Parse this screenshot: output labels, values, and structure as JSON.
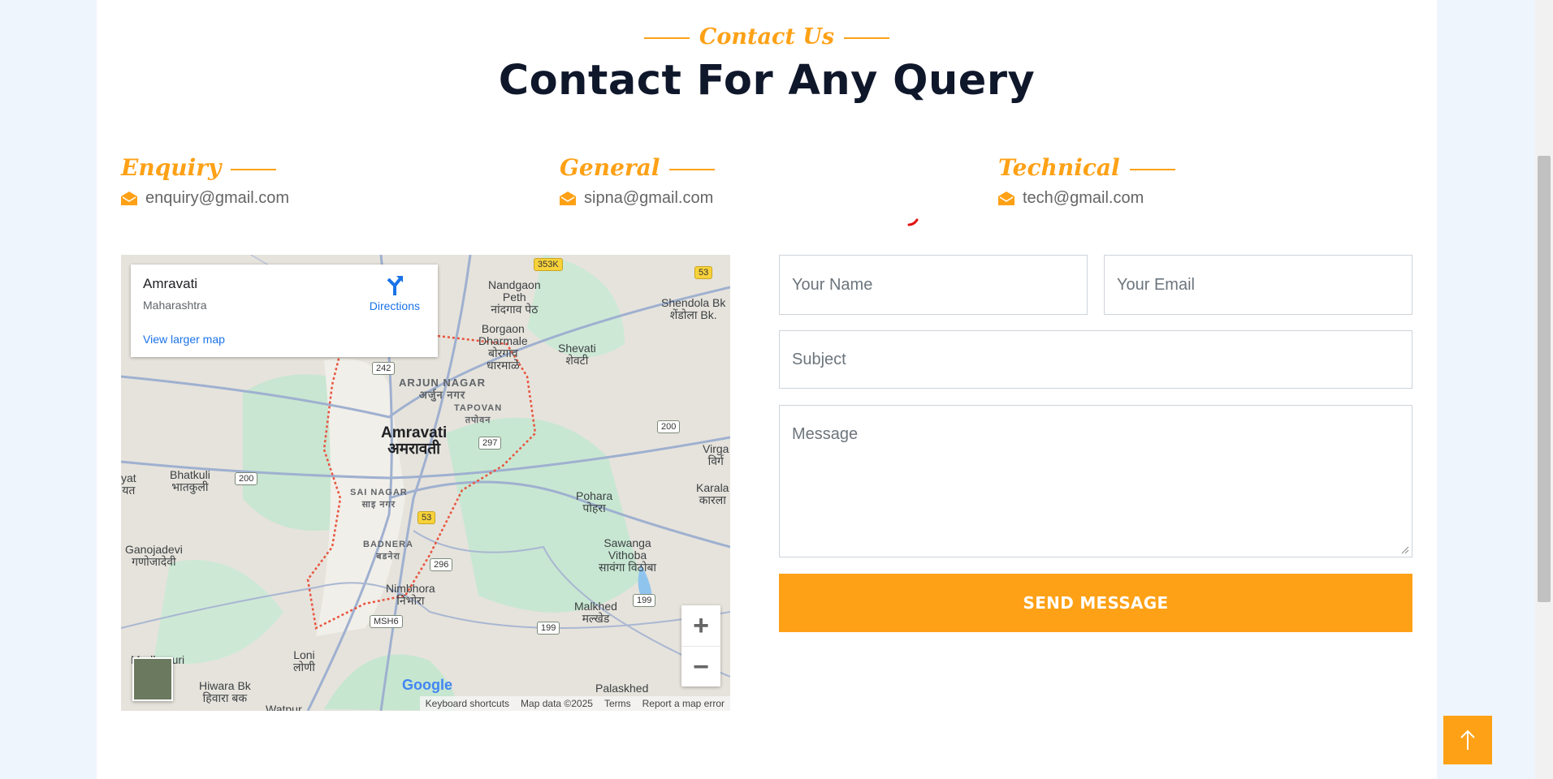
{
  "section": {
    "subtitle": "Contact Us",
    "title": "Contact For Any Query"
  },
  "contacts": [
    {
      "heading": "Enquiry",
      "email": "enquiry@gmail.com",
      "icon": "envelope-open-icon"
    },
    {
      "heading": "General",
      "email": "sipna@gmail.com",
      "icon": "envelope-open-icon"
    },
    {
      "heading": "Technical",
      "email": "tech@gmail.com",
      "icon": "envelope-open-icon"
    }
  ],
  "map": {
    "place": "Amravati",
    "region": "Maharashtra",
    "directions_label": "Directions",
    "larger_map_label": "View larger map",
    "zoom_in": "+",
    "zoom_out": "−",
    "google": "Google",
    "footer": {
      "shortcuts": "Keyboard shortcuts",
      "map_data": "Map data ©2025",
      "terms": "Terms",
      "report": "Report a map error"
    },
    "labels": {
      "amravati_en": "Amravati",
      "amravati_mr": "अमरावती",
      "arjun_nagar_en": "ARJUN NAGAR",
      "arjun_nagar_mr": "अर्जुन नगर",
      "tapovan_en": "TAPOVAN",
      "tapovan_mr": "तपोवन",
      "nandgaon_en": "Nandgaon",
      "nandgaon_en2": "Peth",
      "nandgaon_mr": "नांदगाव पेठ",
      "borgaon_en": "Borgaon",
      "borgaon_en2": "Dharmale",
      "borgaon_mr": "बोरगाव",
      "borgaon_mr2": "धारमाळे",
      "shevati_en": "Shevati",
      "shevati_mr": "शेवटी",
      "shendola_en": "Shendola Bk",
      "shendola_mr": "शेंडोला Bk.",
      "bhatkuli_en": "Bhatkuli",
      "bhatkuli_mr": "भातकुली",
      "sai_nagar_en": "SAI NAGAR",
      "sai_nagar_mr": "साइ नगर",
      "badnera_en": "BADNERA",
      "badnera_mr": "बडनेरा",
      "pohara_en": "Pohara",
      "pohara_mr": "पोहरा",
      "ganojadevi_en": "Ganojadevi",
      "ganojadevi_mr": "गणोजादेवी",
      "sawanga_en": "Sawanga",
      "sawanga_en2": "Vithoba",
      "sawanga_mr": "सावंगा विठोबा",
      "nimbhora_en": "Nimbhora",
      "nimbhora_mr": "निंभोरा",
      "malkhed_en": "Malkhed",
      "malkhed_mr": "मल्खेड",
      "loni_en": "Loni",
      "loni_mr": "लोणी",
      "hiwara_en": "Hiwara Bk",
      "hiwara_mr": "हिवारा बक",
      "palaskhed_en": "Palaskhed",
      "karala_en": "Karala",
      "karala_mr": "कारला",
      "virga_en": "Virga",
      "virga_mr": "विर्ग",
      "yat_en": "yat",
      "yat_mr": "यत",
      "madhapuri": "Madhapuri",
      "watpur": "Watpur"
    },
    "shields": {
      "s353k": "353K",
      "s53a": "53",
      "s242": "242",
      "s297": "297",
      "s200a": "200",
      "s200b": "200",
      "s53b": "53",
      "s296": "296",
      "smsh6": "MSH6",
      "s199a": "199",
      "s199b": "199"
    }
  },
  "form": {
    "name_placeholder": "Your Name",
    "email_placeholder": "Your Email",
    "subject_placeholder": "Subject",
    "message_placeholder": "Message",
    "submit_label": "SEND MESSAGE"
  },
  "back_to_top_icon": "arrow-up-icon",
  "colors": {
    "accent": "#fea116",
    "title": "#0f172b",
    "page_bg": "#eef5fd",
    "text_muted": "#666565"
  }
}
